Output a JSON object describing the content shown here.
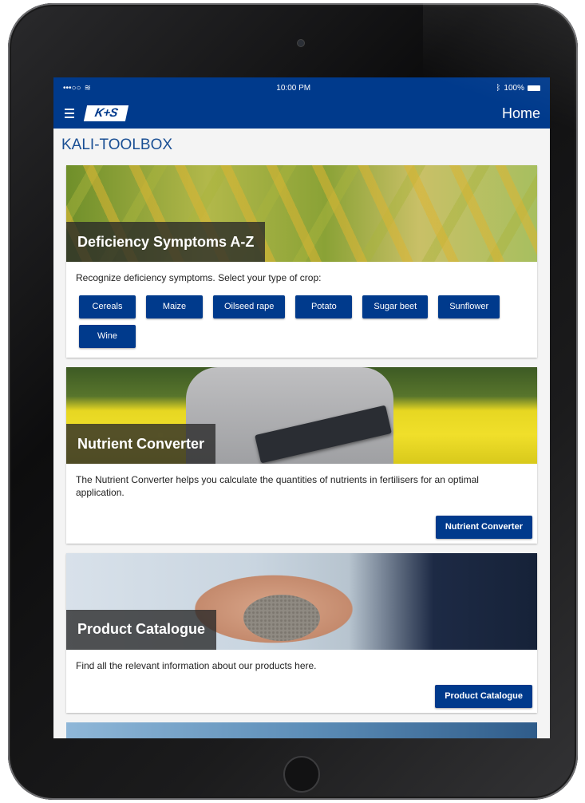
{
  "status_bar": {
    "signal": "•••○○",
    "time": "10:00 PM",
    "battery_text": "100%"
  },
  "nav": {
    "logo_text": "K+S",
    "home_label": "Home"
  },
  "page_title": "KALI-TOOLBOX",
  "cards": {
    "deficiency": {
      "title": "Deficiency Symptoms A-Z",
      "description": "Recognize deficiency symptoms. Select your type of crop:",
      "crops": [
        "Cereals",
        "Maize",
        "Oilseed rape",
        "Potato",
        "Sugar beet",
        "Sunflower",
        "Wine"
      ]
    },
    "nutrient": {
      "title": "Nutrient Converter",
      "description": "The Nutrient Converter helps you calculate the quantities of nutrients in fertilisers for an optimal application.",
      "button": "Nutrient Converter"
    },
    "catalogue": {
      "title": "Product Catalogue",
      "description": "Find all the relevant information about our products here.",
      "button": "Product Catalogue"
    }
  },
  "colors": {
    "brand_blue": "#003a8c",
    "title_blue": "#1a4f94"
  }
}
